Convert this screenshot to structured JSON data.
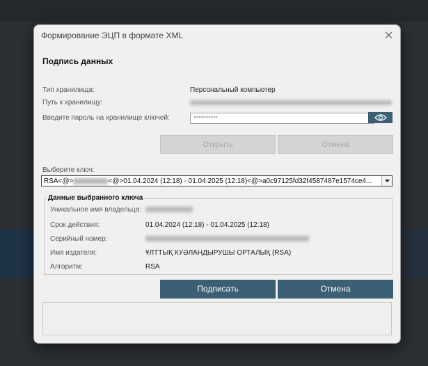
{
  "window": {
    "title": "Формирование ЭЦП в формате XML"
  },
  "section_title": "Подпись данных",
  "storage": {
    "type_label": "Тип хранилища:",
    "type_value": "Персональный компьютер",
    "path_label": "Путь к хранилищу:",
    "password_label": "Введите пароль на хранилище ключей:",
    "password_value": "**********"
  },
  "buttons": {
    "top_left": "Открыть",
    "top_right": "Отмена",
    "sign": "Подписать",
    "cancel": "Отмена"
  },
  "key_select": {
    "label": "Выберите ключ:",
    "prefix": "RSA<@>",
    "rest": "<@>01.04.2024 (12:18) - 01.04.2025 (12:18)<@>a0c97125fd32f4587487e1574ce4..."
  },
  "key_details": {
    "title": "Данные выбранного ключа",
    "owner_label": "Уникальное имя владельца:",
    "validity_label": "Срок действия:",
    "validity_value": "01.04.2024 (12:18) - 01.04.2025 (12:18)",
    "serial_label": "Серийный номер:",
    "issuer_label": "Имя издателя:",
    "issuer_value": "ҰЛТТЫҚ КУӘЛАНДЫРУШЫ ОРТАЛЫҚ (RSA)",
    "algorithm_label": "Алгоритм:",
    "algorithm_value": "RSA"
  },
  "colors": {
    "primary_button": "#3b5f73",
    "dialog_bg": "#f0f0f0"
  },
  "icons": {
    "close": "close-icon",
    "eye": "eye-icon",
    "dropdown": "chevron-down-icon"
  }
}
